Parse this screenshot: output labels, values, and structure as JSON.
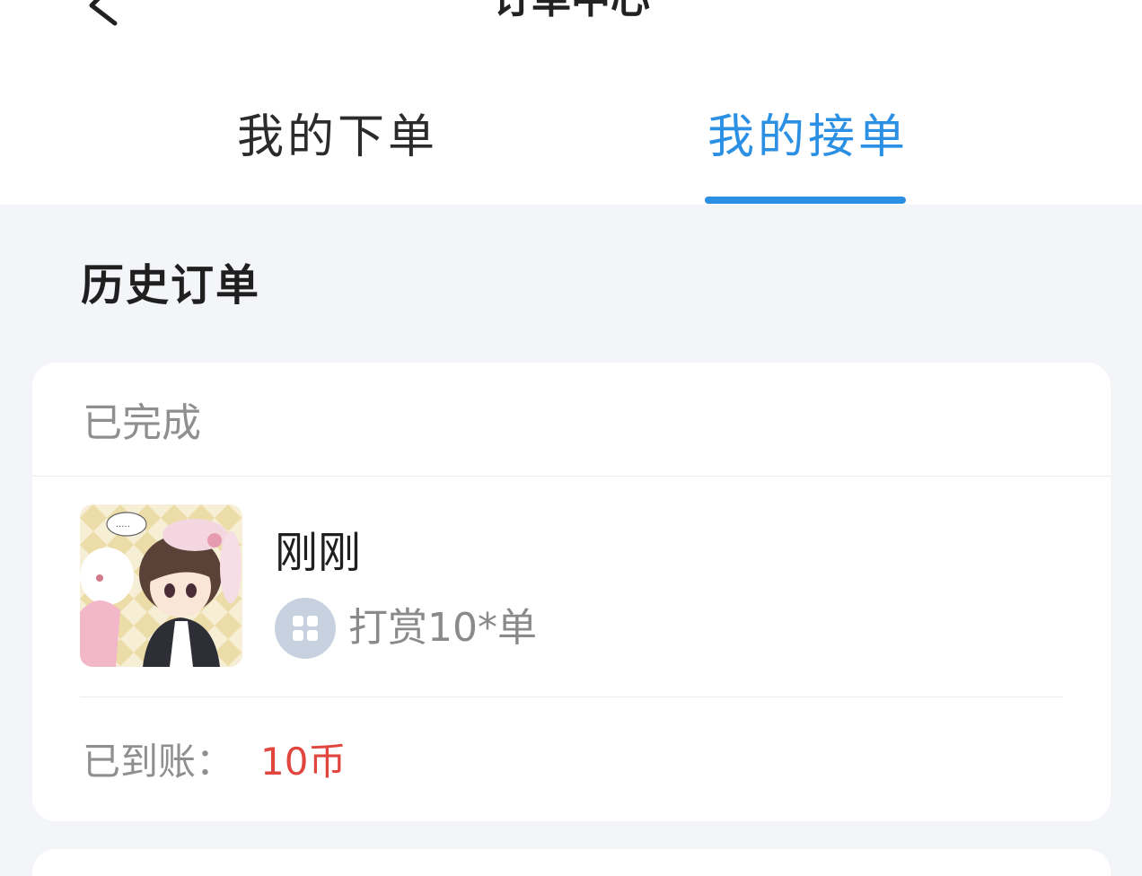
{
  "header": {
    "title": "订单中心"
  },
  "tabs": [
    {
      "label": "我的下单",
      "active": false
    },
    {
      "label": "我的接单",
      "active": true
    }
  ],
  "colors": {
    "accent": "#2b8fe3",
    "amount": "#e0463e",
    "background": "#f4f5f9"
  },
  "section": {
    "heading": "历史订单"
  },
  "order": {
    "status": "已完成",
    "time": "刚刚",
    "description": "打赏10*单",
    "received_label": "已到账：",
    "received_amount": "10币"
  },
  "icons": {
    "back": "chevron-left-icon",
    "game": "grid-apps-icon",
    "thumbnail": "anime-avatar-image"
  }
}
